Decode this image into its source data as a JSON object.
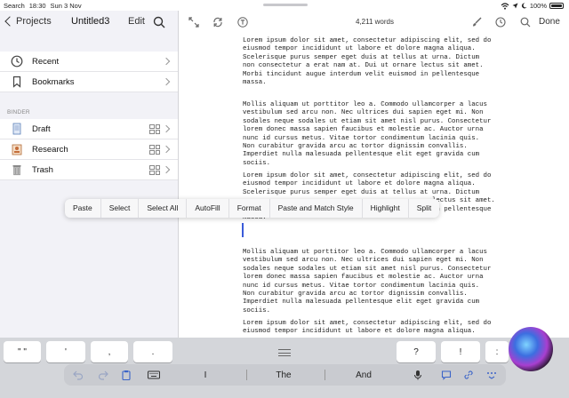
{
  "status_bar": {
    "search": "Search",
    "time": "18:30",
    "date": "Sun 3 Nov",
    "battery": "100%"
  },
  "sidebar": {
    "back_label": "Projects",
    "title": "Untitled3",
    "edit_label": "Edit",
    "top_items": [
      {
        "label": "Recent",
        "icon": "clock-icon"
      },
      {
        "label": "Bookmarks",
        "icon": "bookmark-icon"
      }
    ],
    "binder_label": "BINDER",
    "binder_items": [
      {
        "label": "Draft",
        "icon": "document-icon"
      },
      {
        "label": "Research",
        "icon": "research-icon"
      },
      {
        "label": "Trash",
        "icon": "trash-icon"
      }
    ]
  },
  "toolbar": {
    "word_count": "4,211 words",
    "done_label": "Done"
  },
  "document": {
    "paragraphs": [
      "Lorem ipsum dolor sit amet, consectetur adipiscing elit, sed do\neiusmod tempor incididunt ut labore et dolore magna aliqua.\nScelerisque purus semper eget duis at tellus at urna. Dictum\nnon consectetur a erat nam at. Dui ut ornare lectus sit amet.\nMorbi tincidunt augue interdum velit euismod in pellentesque\nmassa.",
      "Mollis aliquam ut porttitor leo a. Commodo ullamcorper a lacus\nvestibulum sed arcu non. Nec ultrices dui sapien eget mi. Non\nsodales neque sodales ut etiam sit amet nisl purus. Consectetur\nlorem donec massa sapien faucibus et molestie ac. Auctor urna\nnunc id cursus metus. Vitae tortor condimentum lacinia quis.\nNon curabitur gravida arcu ac tortor dignissim convallis.\nImperdiet nulla malesuada pellentesque elit eget gravida cum\nsociis.",
      "Lorem ipsum dolor sit amet, consectetur adipiscing elit, sed do\neiusmod tempor incididunt ut labore et dolore magna aliqua.\nScelerisque purus semper eget duis at tellus at urna. Dictum\n                                                lectus sit amet.\n                                                in pellentesque\nmassa.",
      "Mollis aliquam ut porttitor leo a. Commodo ullamcorper a lacus\nvestibulum sed arcu non. Nec ultrices dui sapien eget mi. Non\nsodales neque sodales ut etiam sit amet nisl purus. Consectetur\nlorem donec massa sapien faucibus et molestie ac. Auctor urna\nnunc id cursus metus. Vitae tortor condimentum lacinia quis.\nNon curabitur gravida arcu ac tortor dignissim convallis.\nImperdiet nulla malesuada pellentesque elit eget gravida cum\nsociis.",
      "Lorem ipsum dolor sit amet, consectetur adipiscing elit, sed do\neiusmod tempor incididunt ut labore et dolore magna aliqua."
    ]
  },
  "edit_menu": [
    "Paste",
    "Select",
    "Select All",
    "AutoFill",
    "Format",
    "Paste and Match Style",
    "Highlight",
    "Split"
  ],
  "keyboard": {
    "keys": [
      {
        "label": "\" \""
      },
      {
        "label": "'"
      },
      {
        "label": ","
      },
      {
        "label": "."
      },
      {
        "label": "?"
      },
      {
        "label": "!"
      },
      {
        "label": ":"
      }
    ],
    "predictions": [
      "I",
      "The",
      "And"
    ]
  }
}
